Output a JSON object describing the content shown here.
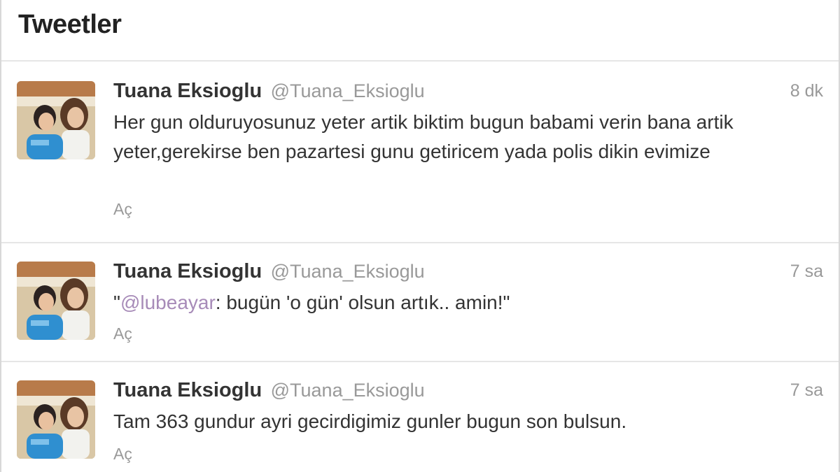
{
  "timeline": {
    "title": "Tweetler"
  },
  "tweets": [
    {
      "fullname": "Tuana Eksioglu",
      "username": "@Tuana_Eksioglu",
      "time": "8 dk",
      "text": "Her gun olduruyosunuz yeter artik biktim bugun babami verin bana artik yeter,gerekirse ben pazartesi gunu getiricem yada polis dikin evimize",
      "expand": "Aç"
    },
    {
      "fullname": "Tuana Eksioglu",
      "username": "@Tuana_Eksioglu",
      "time": "7 sa",
      "text_prefix": "\"",
      "mention": "@lubeayar",
      "text_suffix": ": bugün 'o gün' olsun artık.. amin!\"",
      "expand": "Aç"
    },
    {
      "fullname": "Tuana Eksioglu",
      "username": "@Tuana_Eksioglu",
      "time": "7 sa",
      "text": "Tam 363 gundur ayri gecirdigimiz gunler bugun son bulsun.",
      "expand": "Aç"
    }
  ],
  "icons": {
    "avatar": "profile-photo"
  }
}
